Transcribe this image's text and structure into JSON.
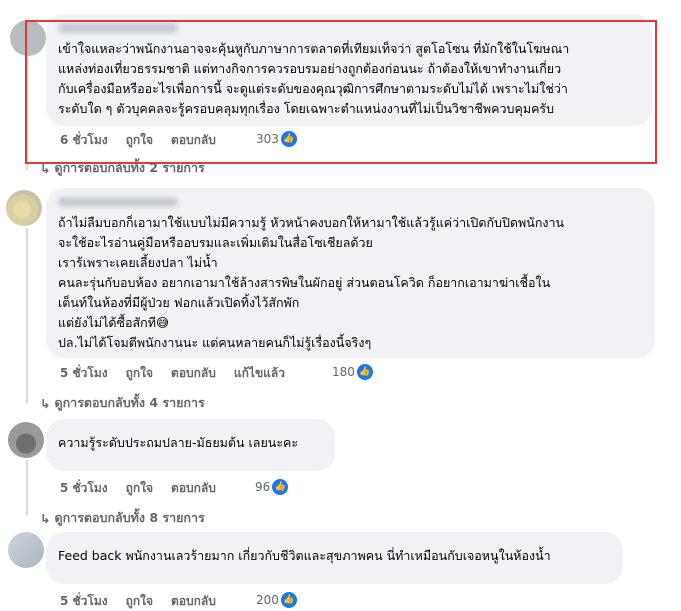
{
  "comments": [
    {
      "text": "เข้าใจแหละว่าพนักงานอาจจะคุ้นหูกับภาษาการตลาดที่เทียมเท็จว่า สูตโอโซน ที่มักใช้ในโฆษณา\nแหล่งท่องเที่ยวธรรมชาติ แต่ทางกิจการควรอบรมอย่างถูกต้องก่อนนะ ถ้าต้องให้เขาทำงานเกี่ยว\nกับเครื่องมือหรืออะไรเพื่อการนี้ จะดูแต่ระดับของคุณวุฒิการศึกษาตามระดับไม่ได้ เพราะไม่ใช่ว่า\nระดับใด ๆ ตัวบุคคลจะรู้ครอบคลุมทุกเรื่อง โดยเฉพาะตำแหน่งงานที่ไม่เป็นวิชาชีพควบคุมครับ",
      "time": "6 ชั่วโมง",
      "like": "ถูกใจ",
      "reply": "ตอบกลับ",
      "edited": "",
      "reactions": "303",
      "replies": "ดูการตอบกลับทั้ง 2 รายการ"
    },
    {
      "text": "ถ้าไม่ลืมบอกก็เอามาใช้แบบไม่มีความรู้ หัวหน้าคงบอกให้หามาใช้แล้วรู้แค่ว่าเปิดกับปิดพนักงาน\nจะใช้อะไรอ่านคู่มือหรืออบรมและเพิ่มเติมในสื่อโซเชียลด้วย\nเราร้เพราะเคยเลี้ยงปลา ไม่น้ำ\nคนละรุ่นกับอบห้อง อยากเอามาใช้ล้างสารพิษในผักอยู่ ส่วนตอนโควิด ก็อยากเอามาฆ่าเชื้อใน\nเต็นท์ในห้องที่มีผู้ป่วย ฟอกแล้วเปิดทิ้งไว้สักพัก\nแต่ยังไม่ได้ซื้อสักที😅\nปล.ไม่ได้โจมตีพนักงานนะ แต่คนหลายคนก็ไม่รู้เรื่องนี้จริงๆ",
      "time": "5 ชั่วโมง",
      "like": "ถูกใจ",
      "reply": "ตอบกลับ",
      "edited": "แก้ไขแล้ว",
      "reactions": "180",
      "replies": "ดูการตอบกลับทั้ง 4 รายการ"
    },
    {
      "text": "ความรู้ระดับประถมปลาย-มัธยมต้น เลยนะคะ",
      "time": "5 ชั่วโมง",
      "like": "ถูกใจ",
      "reply": "ตอบกลับ",
      "edited": "",
      "reactions": "96",
      "replies": "ดูการตอบกลับทั้ง 8 รายการ"
    },
    {
      "text": "Feed back พนักงานเลวร้ายมาก เกี่ยวกับชีวิตและสุขภาพคน นี่ทำเหมือนกับเจอหนูในห้องน้ำ",
      "time": "5 ชั่วโมง",
      "like": "ถูกใจ",
      "reply": "ตอบกลับ",
      "edited": "",
      "reactions": "200",
      "replies": ""
    }
  ],
  "icons": {
    "like_badge": "thumbs-up-icon",
    "reply_arrow": "reply-arrow-icon"
  },
  "colors": {
    "highlight": "#e53935",
    "like_blue": "#1877f2",
    "bubble": "#f0f2f5",
    "meta": "#65676b"
  }
}
